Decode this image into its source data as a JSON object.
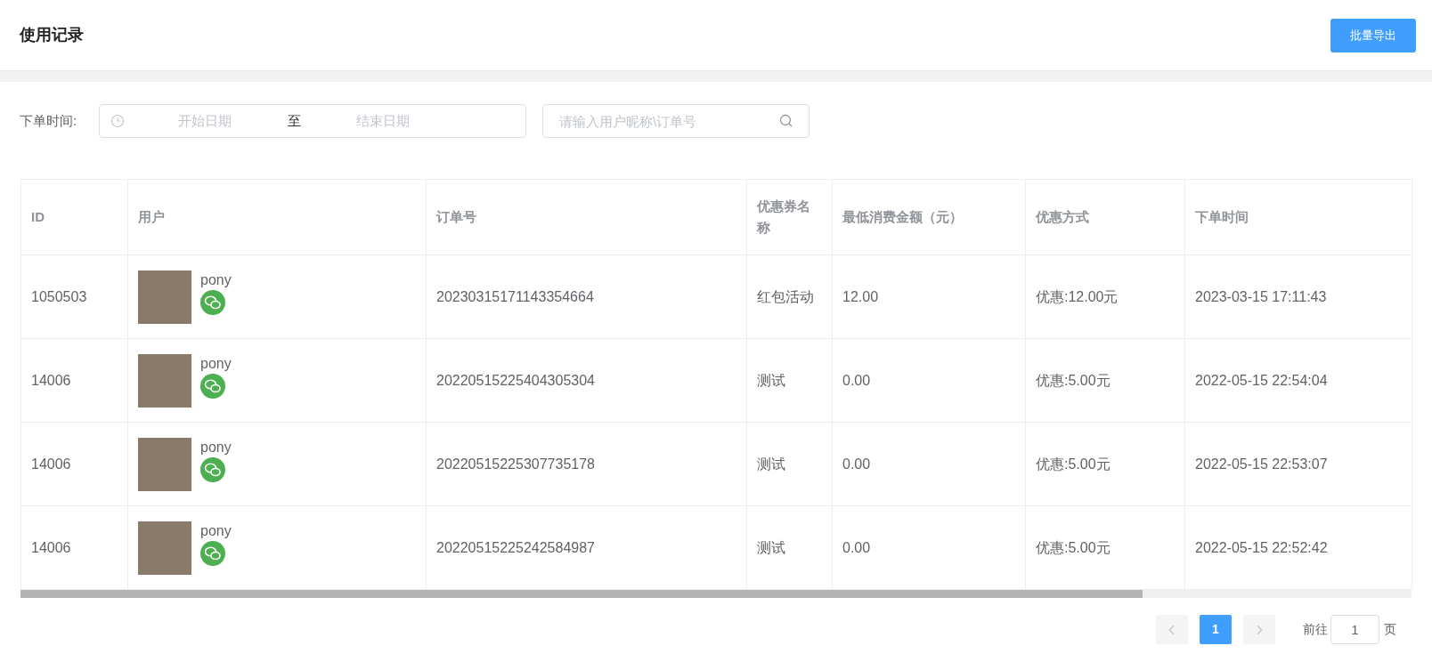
{
  "header": {
    "title": "使用记录",
    "export_button": "批量导出"
  },
  "filters": {
    "label": "下单时间:",
    "start_placeholder": "开始日期",
    "separator": "至",
    "end_placeholder": "结束日期",
    "search_placeholder": "请输入用户昵称\\订单号"
  },
  "table": {
    "columns": [
      "ID",
      "用户",
      "订单号",
      "优惠券名称",
      "最低消费金额（元）",
      "优惠方式",
      "下单时间"
    ],
    "rows": [
      {
        "id": "1050503",
        "user": "pony",
        "order": "20230315171143354664",
        "coupon": "红包活动",
        "min_amount": "12.00",
        "discount": "优惠:12.00元",
        "time": "2023-03-15 17:11:43"
      },
      {
        "id": "14006",
        "user": "pony",
        "order": "20220515225404305304",
        "coupon": "测试",
        "min_amount": "0.00",
        "discount": "优惠:5.00元",
        "time": "2022-05-15 22:54:04"
      },
      {
        "id": "14006",
        "user": "pony",
        "order": "20220515225307735178",
        "coupon": "测试",
        "min_amount": "0.00",
        "discount": "优惠:5.00元",
        "time": "2022-05-15 22:53:07"
      },
      {
        "id": "14006",
        "user": "pony",
        "order": "20220515225242584987",
        "coupon": "测试",
        "min_amount": "0.00",
        "discount": "优惠:5.00元",
        "time": "2022-05-15 22:52:42"
      }
    ]
  },
  "pagination": {
    "prev_disabled": true,
    "next_disabled": true,
    "pages": [
      {
        "label": "1",
        "selected": true
      }
    ],
    "goto_label": "前往",
    "goto_value": "1",
    "goto_suffix": "页"
  }
}
